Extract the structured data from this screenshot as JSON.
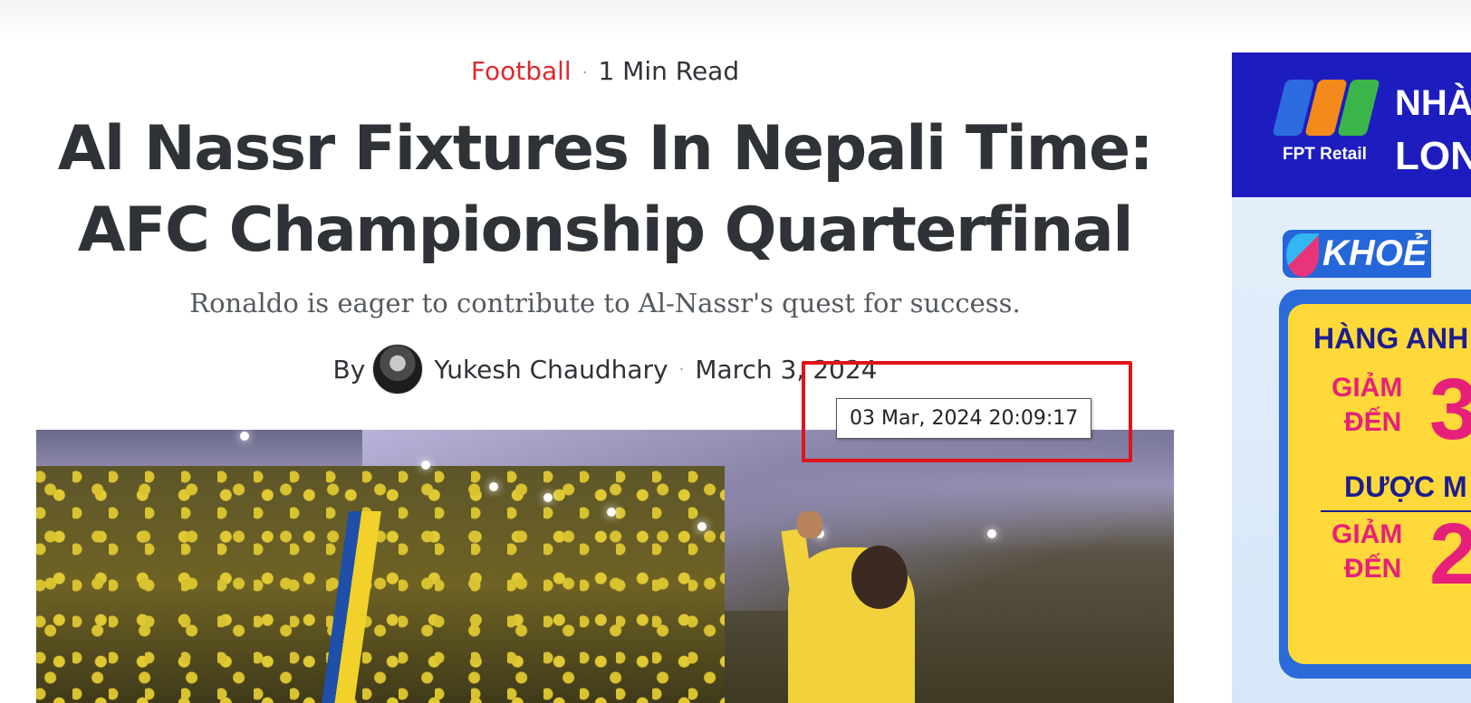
{
  "article": {
    "category": "Football",
    "read_time": "1 Min Read",
    "title": "Al Nassr Fixtures In Nepali Time: AFC Championship Quarterfinal",
    "subtitle": "Ronaldo is eager to contribute to Al-Nassr's quest for success.",
    "byline_prefix": "By",
    "author": "Yukesh Chaudhary",
    "date": "March 3, 2024",
    "separator": "·"
  },
  "tooltip": {
    "text": "03 Mar, 2024 20:09:17"
  },
  "ad": {
    "brand": "FPT Retail",
    "headline_1": "NHÀ",
    "headline_2": "LON",
    "tag": "KHOẺ",
    "line_1": "HÀNG ANH",
    "giam_1": "GIẢM",
    "den_1": "ĐẾN",
    "num_1": "3",
    "line_2": "DƯỢC M",
    "giam_2": "GIẢM",
    "den_2": "ĐẾN",
    "num_2": "2",
    "colors": {
      "banner": "#1d1dbf",
      "accent_pink": "#e6207a",
      "card_yellow": "#ffd93a",
      "card_blue": "#2a6ad9"
    }
  },
  "colors": {
    "category": "#e0282e",
    "text": "#2f3337",
    "highlight": "#e0141b"
  }
}
